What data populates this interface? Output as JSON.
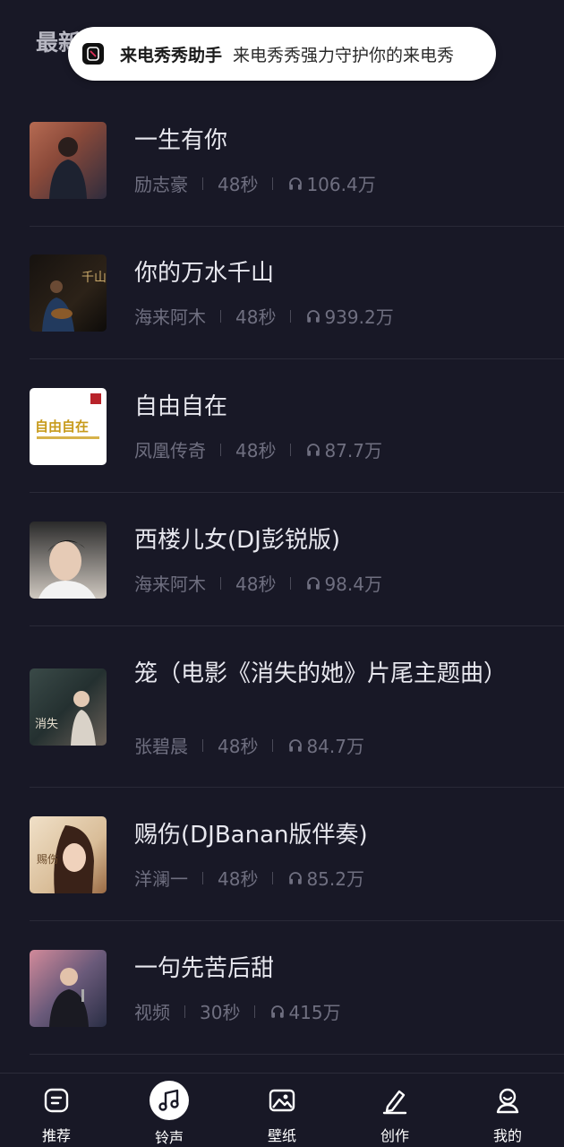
{
  "header": {
    "section_title": "最新"
  },
  "toast": {
    "app_name": "来电秀秀助手",
    "message": "来电秀秀强力守护你的来电秀"
  },
  "songs": [
    {
      "title": "一生有你",
      "artist": "励志豪",
      "duration": "48秒",
      "plays": "106.4万",
      "cover_colors": [
        "#a05040",
        "#3a2a44"
      ]
    },
    {
      "title": "你的万水千山",
      "artist": "海来阿木",
      "duration": "48秒",
      "plays": "939.2万",
      "cover_colors": [
        "#1a1512",
        "#3a2a1c"
      ]
    },
    {
      "title": "自由自在",
      "artist": "凤凰传奇",
      "duration": "48秒",
      "plays": "87.7万",
      "cover_colors": [
        "#ffffff",
        "#f3efe6"
      ]
    },
    {
      "title": "西楼儿女(DJ彭锐版)",
      "artist": "海来阿木",
      "duration": "48秒",
      "plays": "98.4万",
      "cover_colors": [
        "#1c1c1c",
        "#e8e2dc"
      ]
    },
    {
      "title": "笼（电影《消失的她》片尾主题曲）",
      "artist": "张碧晨",
      "duration": "48秒",
      "plays": "84.7万",
      "cover_colors": [
        "#2e3a3a",
        "#b3a99e"
      ]
    },
    {
      "title": "赐伤(DJBanan版伴奏)",
      "artist": "洋澜一",
      "duration": "48秒",
      "plays": "85.2万",
      "cover_colors": [
        "#e9d6b8",
        "#7a4a30"
      ]
    },
    {
      "title": "一句先苦后甜",
      "artist": "视频",
      "duration": "30秒",
      "plays": "415万",
      "cover_colors": [
        "#c08a8a",
        "#2a2e45"
      ]
    }
  ],
  "tabs": [
    {
      "label": "推荐",
      "icon": "recommend-icon"
    },
    {
      "label": "铃声",
      "icon": "music-note-icon",
      "active": true
    },
    {
      "label": "壁纸",
      "icon": "image-icon"
    },
    {
      "label": "创作",
      "icon": "pen-icon"
    },
    {
      "label": "我的",
      "icon": "profile-icon"
    }
  ],
  "colors": {
    "background": "#181826",
    "text_primary": "#e7e7ee",
    "text_secondary": "#6f6f80",
    "divider": "#2a2a38"
  }
}
